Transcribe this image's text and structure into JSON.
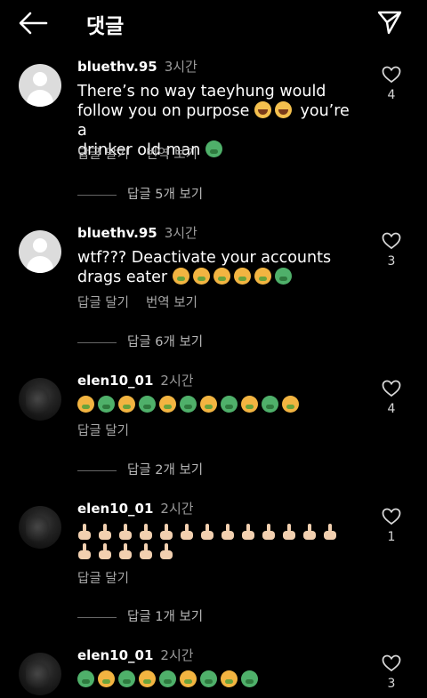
{
  "header": {
    "title": "댓글"
  },
  "colors": {
    "background": "#000000",
    "muted": "#a8a8a8"
  },
  "comments": [
    {
      "username": "bluethv.95",
      "time": "3시간",
      "avatar": "default",
      "text_lines": [
        "There’s no way taeyhung would",
        "follow you on purpose",
        "you’re a",
        "drinker old man"
      ],
      "reply_label": "답글 달기",
      "translate_label": "번역 보기",
      "likes": "4",
      "view_replies": "답글 5개 보기"
    },
    {
      "username": "bluethv.95",
      "time": "3시간",
      "avatar": "default",
      "text_lines": [
        "wtf??? Deactivate your accounts",
        "drags eater"
      ],
      "reply_label": "답글 달기",
      "translate_label": "번역 보기",
      "likes": "3",
      "view_replies": "답글 6개 보기"
    },
    {
      "username": "elen10_01",
      "time": "2시간",
      "avatar": "dark",
      "reply_label": "답글 달기",
      "likes": "4",
      "view_replies": "답글 2개 보기"
    },
    {
      "username": "elen10_01",
      "time": "2시간",
      "avatar": "dark",
      "reply_label": "답글 달기",
      "likes": "1",
      "view_replies": "답글 1개 보기"
    },
    {
      "username": "elen10_01",
      "time": "2시간",
      "avatar": "dark",
      "likes": "3"
    }
  ],
  "icons": {
    "back": "arrow-left-icon",
    "send": "paper-plane-icon",
    "like": "heart-outline-icon",
    "emoji_sick": "nauseated-face-emoji",
    "emoji_laugh": "tears-of-joy-emoji",
    "emoji_finger": "middle-finger-emoji"
  }
}
